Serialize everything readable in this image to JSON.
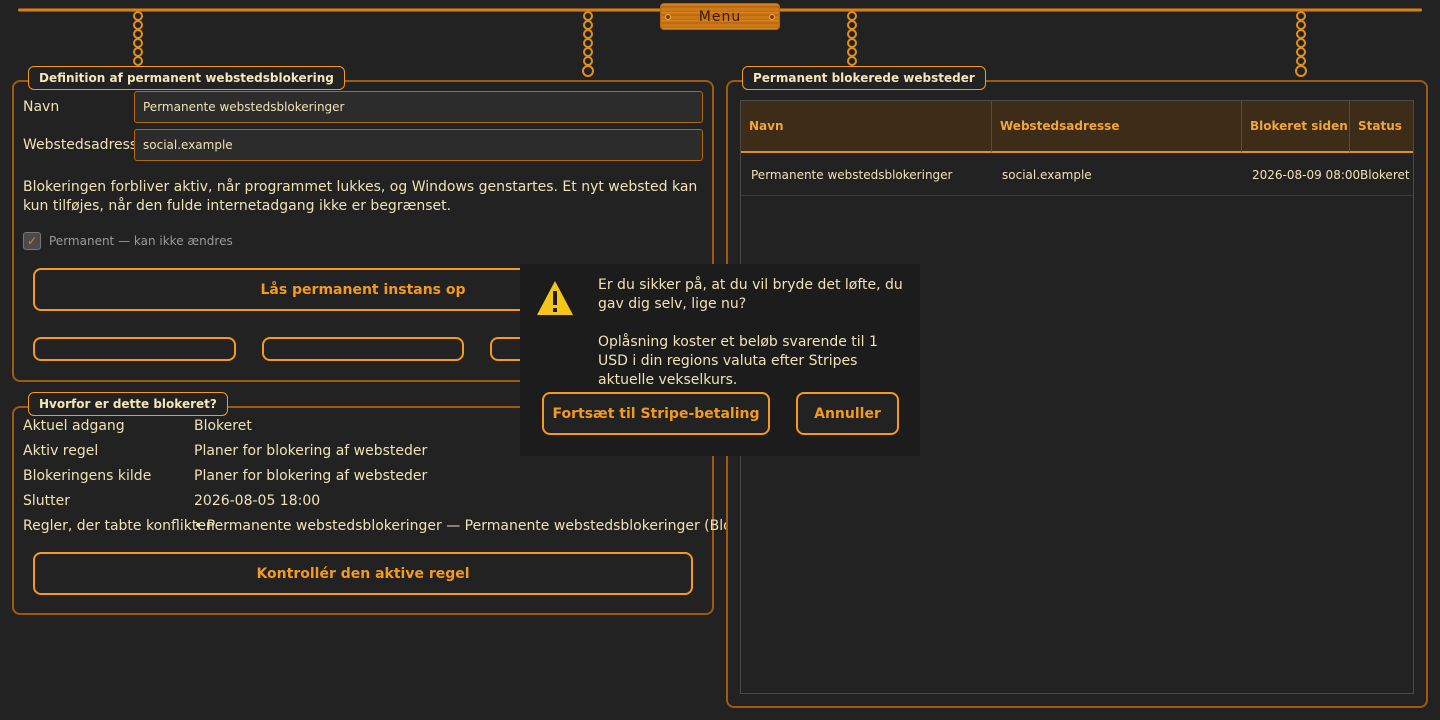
{
  "menu": {
    "label": "Menu"
  },
  "definition": {
    "title": "Definition af permanent webstedsblokering",
    "name_label": "Navn",
    "name_value": "Permanente webstedsblokeringer",
    "address_label": "Webstedsadresse",
    "address_value": "social.example",
    "info": "Blokeringen forbliver aktiv, når programmet lukkes, og Windows genstartes. Et nyt websted kan kun tilføjes, når den fulde internetadgang ikke er begrænset.",
    "checkbox_label": "Permanent — kan ikke ændres",
    "checkbox_checked": true,
    "unlock_button": "Lås permanent instans op"
  },
  "why": {
    "title": "Hvorfor er dette blokeret?",
    "rows": [
      {
        "label": "Aktuel adgang",
        "value": "Blokeret"
      },
      {
        "label": "Aktiv regel",
        "value": "Planer for blokering af websteder"
      },
      {
        "label": "Blokeringens kilde",
        "value": "Planer for blokering af websteder"
      },
      {
        "label": "Slutter",
        "value": "2026-08-05 18:00"
      },
      {
        "label": "Regler, der tabte konflikten",
        "value": "• Permanente webstedsblokeringer — Permanente webstedsblokeringer (Blokeret)"
      }
    ],
    "check_button": "Kontrollér den aktive regel"
  },
  "blocked_sites": {
    "title": "Permanent blokerede websteder",
    "columns": [
      "Navn",
      "Webstedsadresse",
      "Blokeret siden",
      "Status"
    ],
    "rows": [
      [
        "Permanente webstedsblokeringer",
        "social.example",
        "2026-08-09 08:00",
        "Blokeret"
      ]
    ]
  },
  "dialog": {
    "icon": "warning-icon",
    "question": "Er du sikker på, at du vil bryde det løfte, du gav dig selv, lige nu?",
    "cost_info": "Oplåsning koster et beløb svarende til 1 USD i din regions valuta efter Stripes aktuelle vekselkurs.",
    "continue_button": "Fortsæt til Stripe-betaling",
    "cancel_button": "Annuller"
  },
  "colors": {
    "accent": "#f39a1f",
    "background": "#222222",
    "text": "#f0e2b4",
    "warning": "#f5c518"
  }
}
